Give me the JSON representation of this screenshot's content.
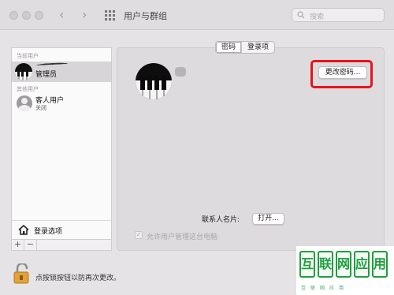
{
  "window": {
    "title": "用户与群组",
    "search_placeholder": "搜索"
  },
  "sidebar": {
    "current_user_heading": "当前用户",
    "current_user": {
      "name": "管理员"
    },
    "other_users_heading": "其他用户",
    "guest": {
      "name": "客人用户",
      "status": "关闭"
    },
    "login_options_label": "登录选项",
    "add_label": "+",
    "remove_label": "−"
  },
  "tabs": [
    {
      "label": "密码",
      "active": true
    },
    {
      "label": "登录项",
      "active": false
    }
  ],
  "main": {
    "change_password_label": "更改密码...",
    "contact_card_label": "联系人名片:",
    "open_label": "打开...",
    "allow_admin_label": "允许用户管理这台电脑"
  },
  "footer": {
    "lock_text": "点按锁按钮以防再次更改。"
  },
  "watermark": {
    "chars": [
      "互",
      "联",
      "网",
      "应",
      "用"
    ],
    "subtitle": "互联网应用"
  },
  "colors": {
    "highlight": "#e8141b",
    "watermark": "#1f9e3e"
  },
  "icons": {
    "back": "chevron-left-icon",
    "forward": "chevron-right-icon",
    "grid": "grid-icon",
    "search": "search-icon",
    "home": "house-icon",
    "lock": "lock-icon"
  }
}
